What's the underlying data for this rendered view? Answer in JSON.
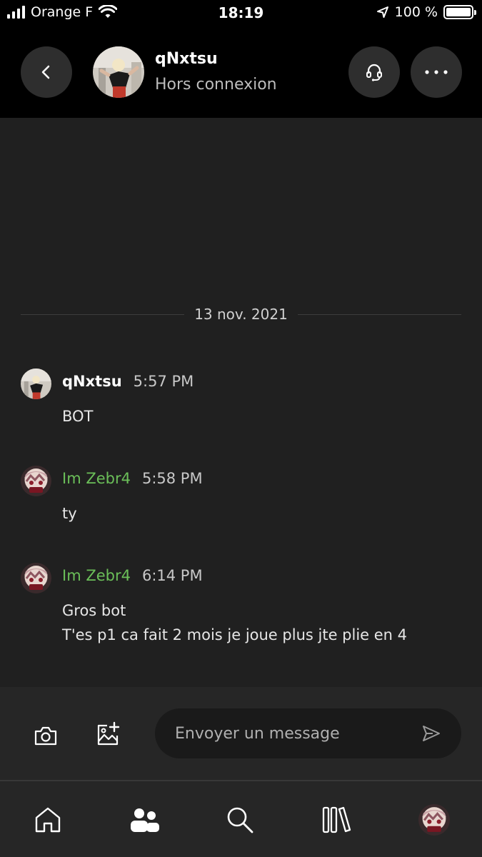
{
  "status_bar": {
    "carrier": "Orange F",
    "time": "18:19",
    "battery": "100 %"
  },
  "header": {
    "name": "qNxtsu",
    "status": "Hors connexion",
    "icons": {
      "back": "chevron-left-icon",
      "voice": "headset-icon",
      "more": "more-horizontal-icon"
    }
  },
  "conversation": {
    "date": "13 nov. 2021",
    "messages": [
      {
        "author": "qNxtsu",
        "time": "5:57 PM",
        "lines": [
          "BOT"
        ]
      },
      {
        "author": "Im Zebr4",
        "time": "5:58 PM",
        "lines": [
          "ty"
        ]
      },
      {
        "author": "Im Zebr4",
        "time": "6:14 PM",
        "lines": [
          "Gros bot",
          "T'es p1 ca fait 2 mois je joue plus jte plie en 4"
        ]
      }
    ]
  },
  "composer": {
    "placeholder": "Envoyer un message",
    "icons": {
      "camera": "camera-icon",
      "image": "add-image-icon",
      "send": "send-icon"
    }
  },
  "nav": {
    "items": [
      "home-icon",
      "friends-icon",
      "search-icon",
      "library-icon",
      "profile-avatar"
    ]
  },
  "colors": {
    "background": "#202020",
    "header": "#000000",
    "accent_name": "#6bbf59"
  }
}
